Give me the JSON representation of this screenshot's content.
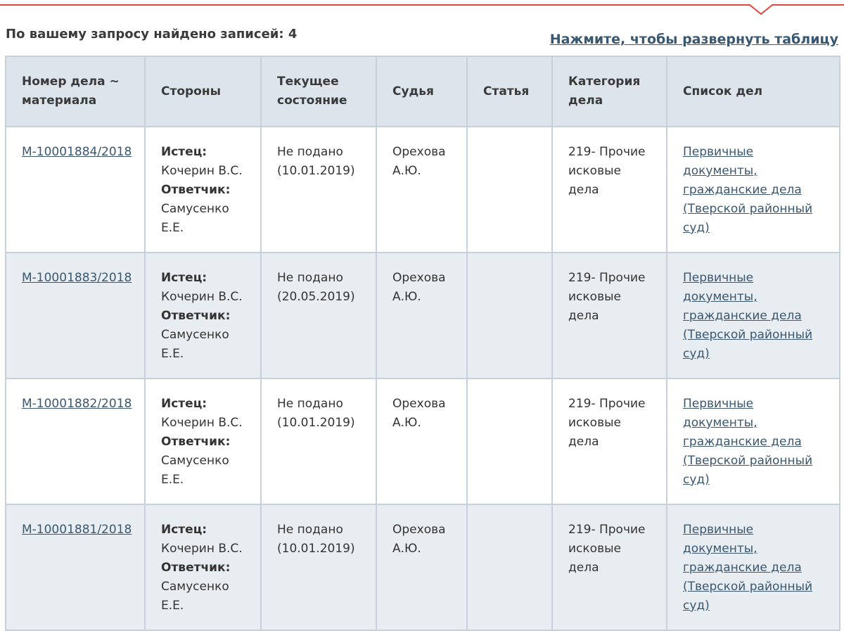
{
  "colors": {
    "accent": "#e0463c",
    "link": "#3a5770",
    "header_bg": "#dde4ec",
    "row_alt_bg": "#e8edf2",
    "border": "#c8d1da"
  },
  "summary": {
    "text": "По вашему запросу найдено записей: 4"
  },
  "expand_link": "Нажмите, чтобы развернуть таблицу",
  "columns": [
    "Номер дела ~ материала",
    "Стороны",
    "Текущее состояние",
    "Судья",
    "Статья",
    "Категория дела",
    "Список дел"
  ],
  "rows": [
    {
      "number": "М-10001884/2018",
      "plaintiff_label": "Истец:",
      "plaintiff": "Кочерин В.С.",
      "defendant_label": "Ответчик:",
      "defendant": "Самусенко Е.Е.",
      "state": "Не подано (10.01.2019)",
      "judge": "Орехова А.Ю.",
      "article": "",
      "category": "219- Прочие исковые дела",
      "list": "Первичные документы, гражданские дела (Тверской районный суд)"
    },
    {
      "number": "М-10001883/2018",
      "plaintiff_label": "Истец:",
      "plaintiff": "Кочерин В.С.",
      "defendant_label": "Ответчик:",
      "defendant": "Самусенко Е.Е.",
      "state": "Не подано (20.05.2019)",
      "judge": "Орехова А.Ю.",
      "article": "",
      "category": "219- Прочие исковые дела",
      "list": "Первичные документы, гражданские дела (Тверской районный суд)"
    },
    {
      "number": "М-10001882/2018",
      "plaintiff_label": "Истец:",
      "plaintiff": "Кочерин В.С.",
      "defendant_label": "Ответчик:",
      "defendant": "Самусенко Е.Е.",
      "state": "Не подано (10.01.2019)",
      "judge": "Орехова А.Ю.",
      "article": "",
      "category": "219- Прочие исковые дела",
      "list": "Первичные документы, гражданские дела (Тверской районный суд)"
    },
    {
      "number": "М-10001881/2018",
      "plaintiff_label": "Истец:",
      "plaintiff": "Кочерин В.С.",
      "defendant_label": "Ответчик:",
      "defendant": "Самусенко Е.Е.",
      "state": "Не подано (10.01.2019)",
      "judge": "Орехова А.Ю.",
      "article": "",
      "category": "219- Прочие исковые дела",
      "list": "Первичные документы, гражданские дела (Тверской районный суд)"
    }
  ]
}
